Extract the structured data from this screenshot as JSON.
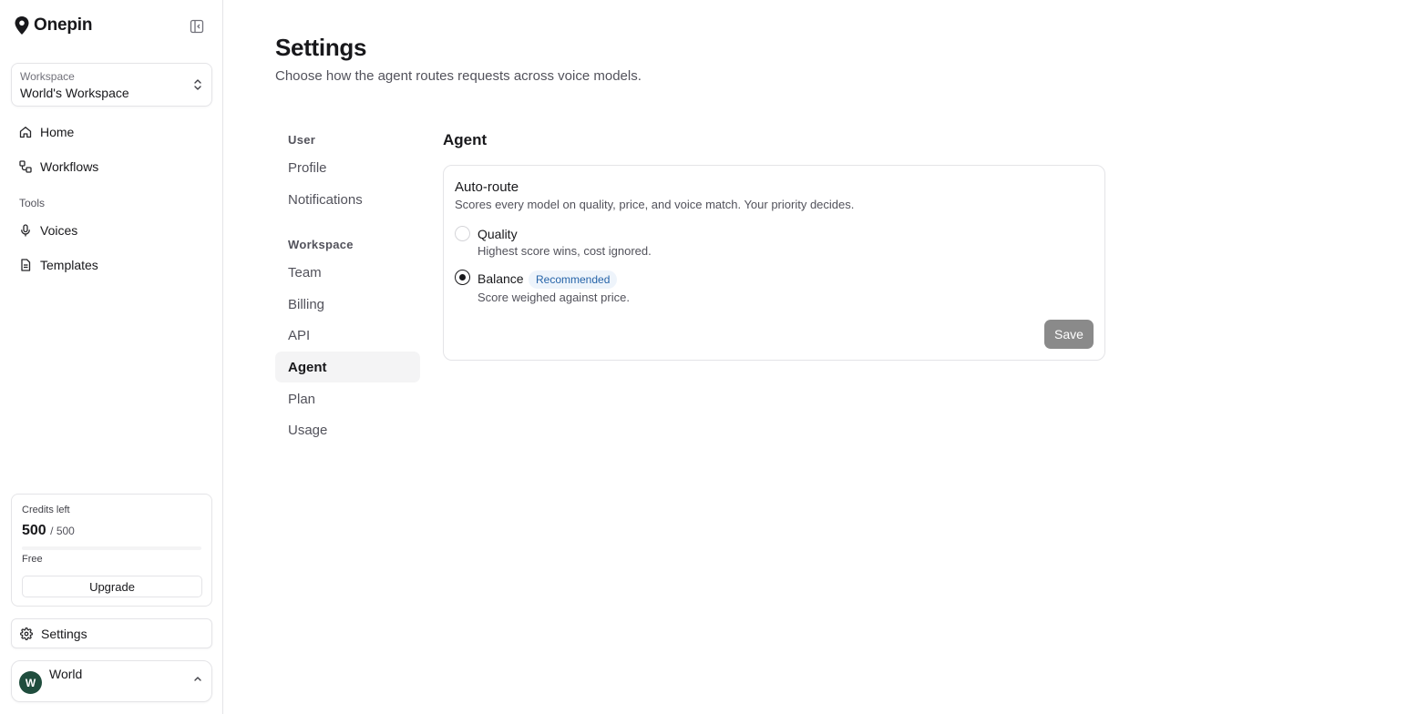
{
  "app": {
    "name": "Onepin"
  },
  "workspace": {
    "label": "Workspace",
    "name": "World's Workspace"
  },
  "sidebar": {
    "nav": [
      {
        "label": "Home",
        "icon": "home-icon"
      },
      {
        "label": "Workflows",
        "icon": "workflow-icon"
      }
    ],
    "tools_label": "Tools",
    "tools": [
      {
        "label": "Voices",
        "icon": "microphone-icon"
      },
      {
        "label": "Templates",
        "icon": "document-icon"
      }
    ],
    "settings_label": "Settings"
  },
  "credits": {
    "title": "Credits left",
    "remaining": "500",
    "total": "/ 500",
    "plan": "Free",
    "upgrade_label": "Upgrade"
  },
  "user": {
    "name": "World",
    "initial": "W",
    "avatar_color": "#1f4d3d"
  },
  "page": {
    "title": "Settings",
    "subtitle": "Choose how the agent routes requests across voice models."
  },
  "settings_nav": {
    "user_label": "User",
    "user_items": [
      "Profile",
      "Notifications"
    ],
    "workspace_label": "Workspace",
    "workspace_items": [
      "Team",
      "Billing",
      "API",
      "Agent",
      "Plan",
      "Usage"
    ],
    "active": "Agent"
  },
  "agent": {
    "section_title": "Agent",
    "card_title": "Auto-route",
    "card_desc": "Scores every model on quality, price, and voice match. Your priority decides.",
    "options": [
      {
        "label": "Quality",
        "desc": "Highest score wins, cost ignored.",
        "selected": false
      },
      {
        "label": "Balance",
        "desc": "Score weighed against price.",
        "selected": true,
        "badge": "Recommended"
      }
    ],
    "save_label": "Save"
  },
  "colors": {
    "badge_bg": "#eef4fb",
    "badge_text": "#2563a8",
    "save_disabled": "#8a8a8a"
  }
}
